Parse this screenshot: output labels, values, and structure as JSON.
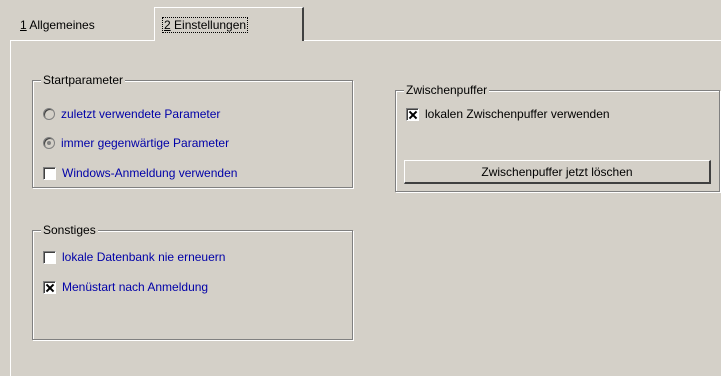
{
  "tabs": [
    {
      "mnemonic": "1",
      "rest": " Allgemeines"
    },
    {
      "mnemonic": "2",
      "rest": " Einstellungen"
    }
  ],
  "startparameter": {
    "title": "Startparameter",
    "options": [
      "zuletzt verwendete Parameter",
      "immer gegenwärtige Parameter",
      "Windows-Anmeldung verwenden"
    ]
  },
  "sonstiges": {
    "title": "Sonstiges",
    "options": [
      "lokale Datenbank nie erneuern",
      "Menüstart nach Anmeldung"
    ]
  },
  "zwischenpuffer": {
    "title": "Zwischenpuffer",
    "checkbox_label": "lokalen Zwischenpuffer verwenden",
    "button_label": "Zwischenpuffer jetzt löschen"
  },
  "state": {
    "radio_zuletzt": false,
    "radio_immer": true,
    "check_windows": false,
    "check_lokale_db": false,
    "check_menustart": true,
    "check_zwischenpuffer": true
  }
}
